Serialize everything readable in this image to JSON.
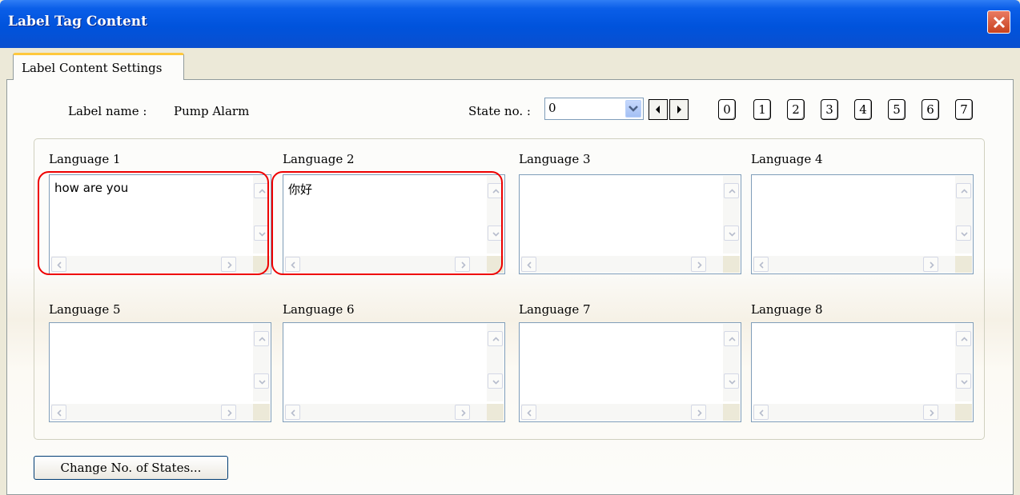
{
  "window": {
    "title": "Label Tag Content"
  },
  "tab": {
    "label": "Label Content Settings"
  },
  "label_name": {
    "caption": "Label name :",
    "value": "Pump Alarm"
  },
  "state": {
    "caption": "State no. :",
    "selected": "0",
    "buttons": [
      "0",
      "1",
      "2",
      "3",
      "4",
      "5",
      "6",
      "7"
    ]
  },
  "languages": [
    {
      "label": "Language 1",
      "text": "how are you",
      "highlighted": true
    },
    {
      "label": "Language 2",
      "text": "你好",
      "highlighted": true
    },
    {
      "label": "Language 3",
      "text": "",
      "highlighted": false
    },
    {
      "label": "Language 4",
      "text": "",
      "highlighted": false
    },
    {
      "label": "Language 5",
      "text": "",
      "highlighted": false
    },
    {
      "label": "Language 6",
      "text": "",
      "highlighted": false
    },
    {
      "label": "Language 7",
      "text": "",
      "highlighted": false
    },
    {
      "label": "Language 8",
      "text": "",
      "highlighted": false
    }
  ],
  "change_states_button": "Change No. of States...",
  "colors": {
    "title_bar": "#0053dc",
    "highlight": "#e00000",
    "tab_accent": "#ffc83c"
  },
  "icons": [
    "close-icon",
    "chevron-down-icon",
    "arrow-left-icon",
    "arrow-right-icon",
    "scroll-up-icon",
    "scroll-down-icon",
    "scroll-left-icon",
    "scroll-right-icon"
  ]
}
